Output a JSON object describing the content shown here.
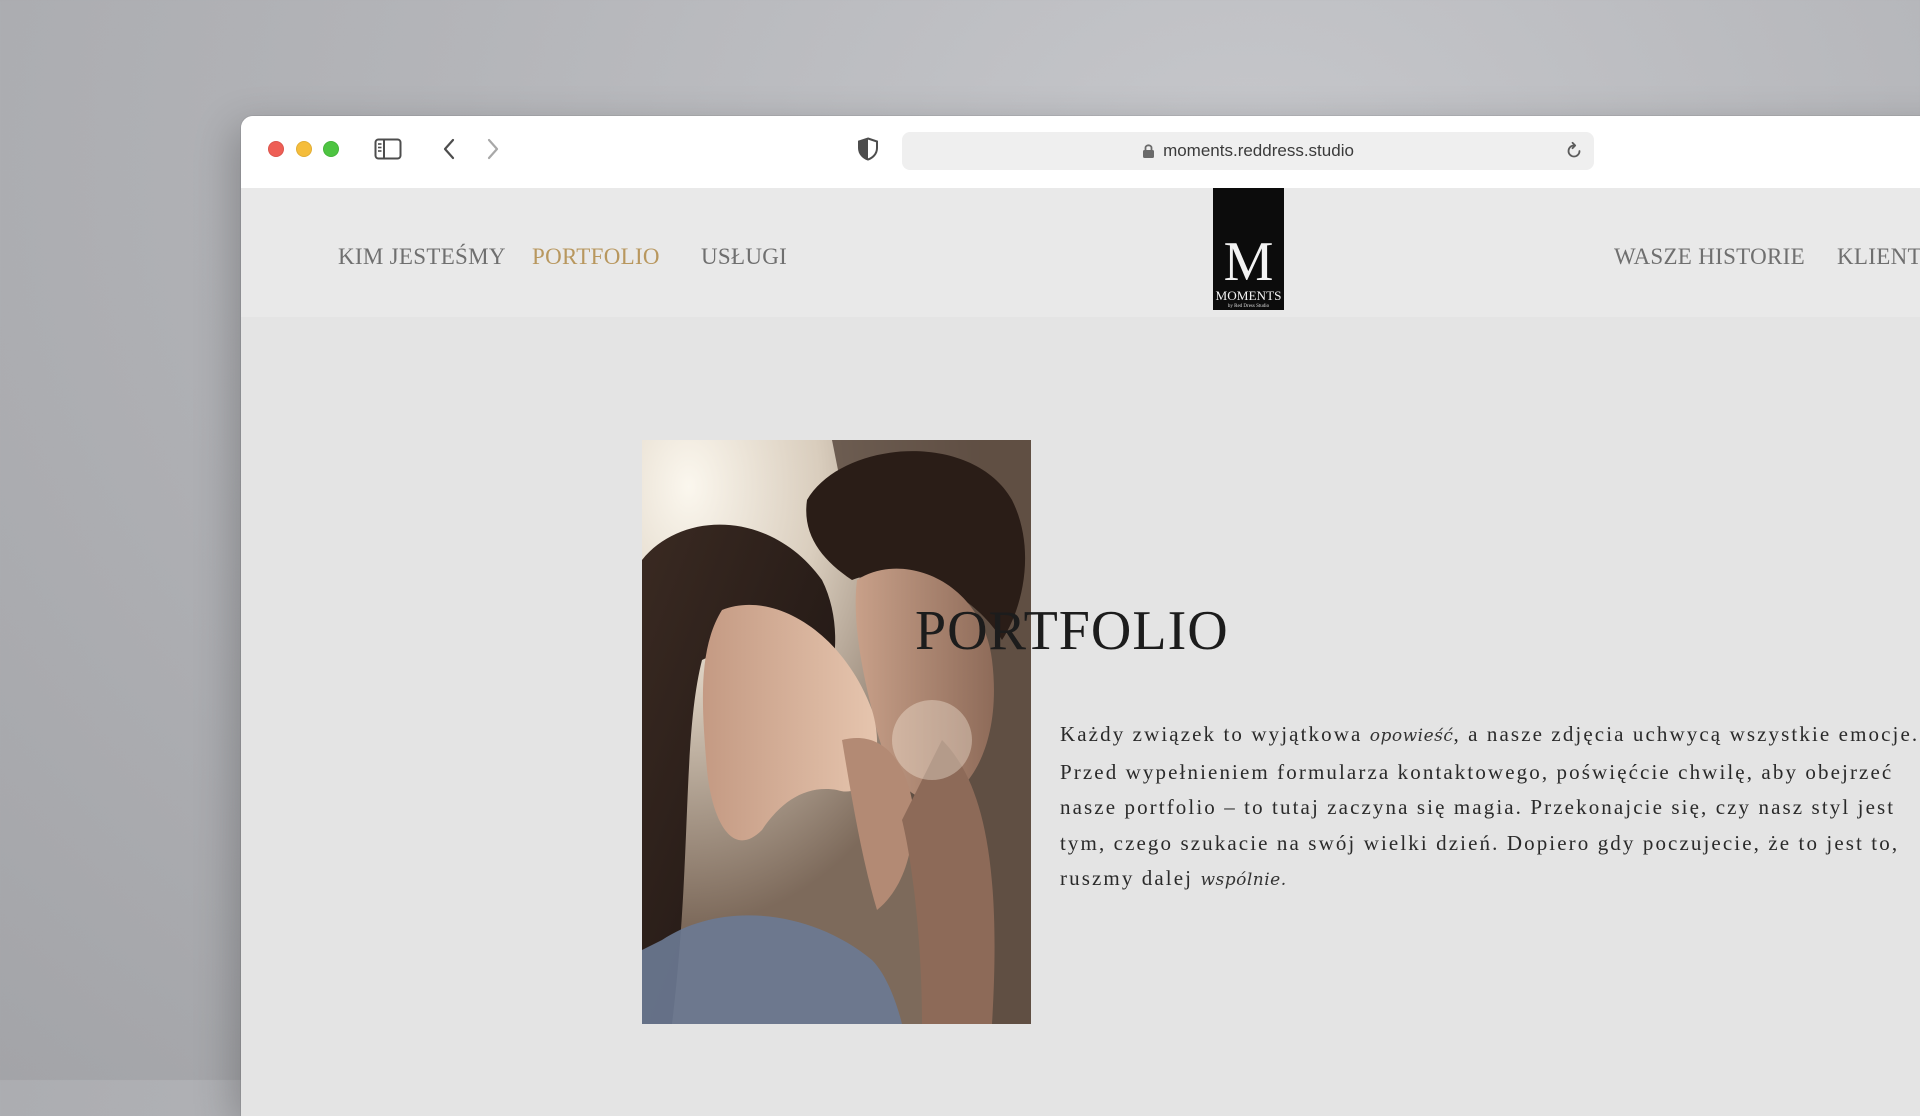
{
  "browser": {
    "url": "moments.reddress.studio",
    "icons": [
      "sidebar-icon",
      "back-icon",
      "forward-icon",
      "shield-icon",
      "lock-icon",
      "reload-icon"
    ]
  },
  "nav": {
    "left": [
      {
        "label": "KIM JESTEŚMY"
      },
      {
        "label": "PORTFOLIO",
        "active": true
      },
      {
        "label": "USŁUGI"
      }
    ],
    "right": [
      {
        "label": "WASZE HISTORIE"
      },
      {
        "label": "KLIENT"
      }
    ],
    "active_color": "#b8975e"
  },
  "logo": {
    "letter": "M",
    "wordmark": "MOMENTS",
    "tagline": "by Red Dress Studio"
  },
  "hero": {
    "title": "PORTFOLIO",
    "intro": [
      {
        "text": "Każdy związek to wyjątkowa "
      },
      {
        "text": "opowieść",
        "style": "script"
      },
      {
        "text": ", a nasze zdjęcia uchwycą wszystkie emocje. Przed wypełnieniem formularza kontaktowego, poświęćcie chwilę, aby obejrzeć nasze portfolio – to tutaj zaczyna się magia. Przekonajcie się, czy nasz styl jest tym, czego szukacie na swój wielki dzień. Dopiero gdy poczujecie, że to jest to, ruszmy dalej "
      },
      {
        "text": "wspólnie.",
        "style": "script"
      }
    ]
  }
}
